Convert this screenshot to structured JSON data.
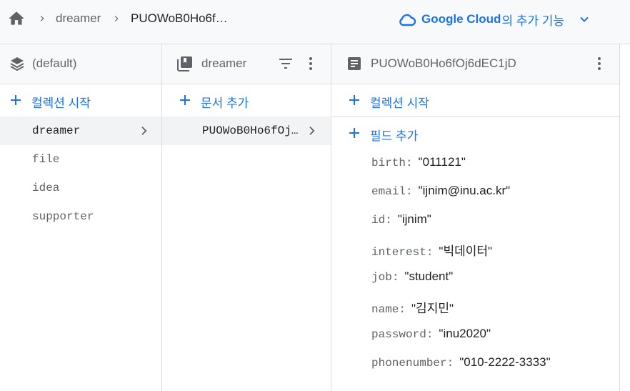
{
  "breadcrumb": {
    "items": [
      "dreamer",
      "PUOWoB0Ho6f…"
    ]
  },
  "promo": {
    "brand": "Google Cloud",
    "suffix": "의 추가 기능"
  },
  "colors": {
    "accent": "#1a73e8",
    "icon": "#5f6368",
    "selected_bg": "#f1f3f4",
    "border": "#dadce0"
  },
  "panel_root": {
    "title": "(default)",
    "icon": "layers-icon",
    "add_label": "컬렉션 시작",
    "collections": [
      "dreamer",
      "file",
      "idea",
      "supporter"
    ],
    "selected": "dreamer"
  },
  "panel_collection": {
    "title": "dreamer",
    "icon": "collection-icon",
    "add_label": "문서 추가",
    "documents": [
      "PUOWoB0Ho6fOj…"
    ],
    "selected": "PUOWoB0Ho6fOj…"
  },
  "panel_document": {
    "title": "PUOWoB0Ho6fOj6dEC1jD",
    "icon": "document-icon",
    "add_collection_label": "컬렉션 시작",
    "add_field_label": "필드 추가",
    "fields": [
      {
        "key": "birth",
        "value": "\"011121\""
      },
      {
        "key": "email",
        "value": "\"ijnim@inu.ac.kr\""
      },
      {
        "key": "id",
        "value": "\"ijnim\""
      },
      {
        "key": "interest",
        "value": "\"빅데이터\""
      },
      {
        "key": "job",
        "value": "\"student\""
      },
      {
        "key": "name",
        "value": "\"김지민\""
      },
      {
        "key": "password",
        "value": "\"inu2020\""
      },
      {
        "key": "phonenumber",
        "value": "\"010-2222-3333\""
      }
    ]
  }
}
